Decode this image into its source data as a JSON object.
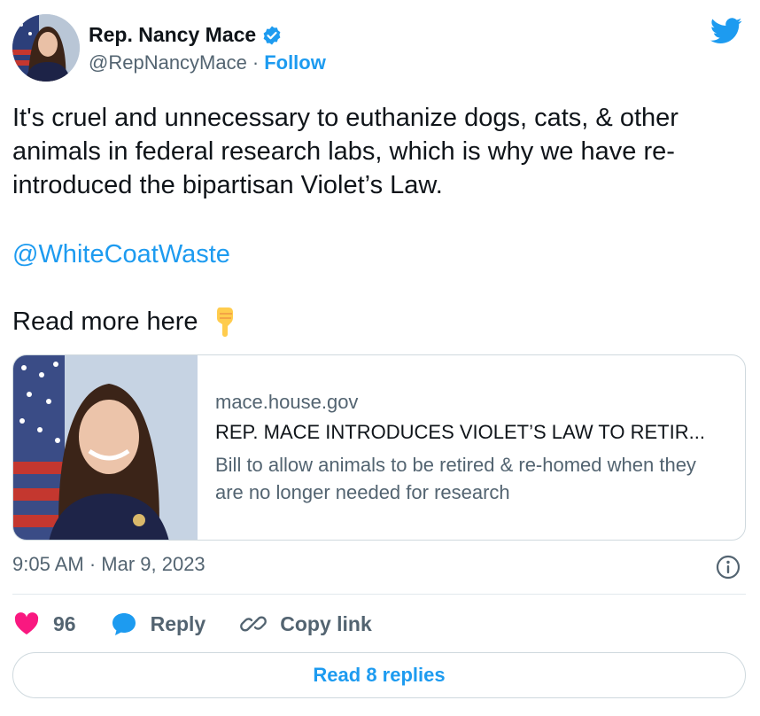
{
  "author": {
    "display_name": "Rep. Nancy Mace",
    "handle": "@RepNancyMace",
    "separator": "·",
    "follow_label": "Follow",
    "verified": true
  },
  "tweet": {
    "text": "It's cruel and unnecessary to euthanize dogs, cats, & other animals in federal research labs, which is why we have re-introduced the bipartisan Violet’s Law.",
    "mention": "@WhiteCoatWaste",
    "read_more": "Read more here"
  },
  "link_card": {
    "domain": "mace.house.gov",
    "title": "REP. MACE INTRODUCES VIOLET’S LAW TO RETIR...",
    "description": "Bill to allow animals to be retired & re-homed when they are no longer needed for research"
  },
  "meta": {
    "timestamp": "9:05 AM · Mar 9, 2023"
  },
  "actions": {
    "like_count": "96",
    "reply_label": "Reply",
    "copy_link_label": "Copy link",
    "read_replies_label": "Read 8 replies"
  },
  "icons": {
    "brand": "twitter-bird-icon",
    "verified": "verified-badge-icon",
    "info": "info-icon",
    "like": "heart-icon",
    "reply": "reply-bubble-icon",
    "copy_link": "link-icon",
    "emoji": "backhand-index-pointing-down-icon"
  },
  "colors": {
    "accent": "#1d9bf0",
    "heart": "#f91880",
    "text": "#0f1419",
    "muted": "#536471",
    "border": "#cfd9de"
  }
}
